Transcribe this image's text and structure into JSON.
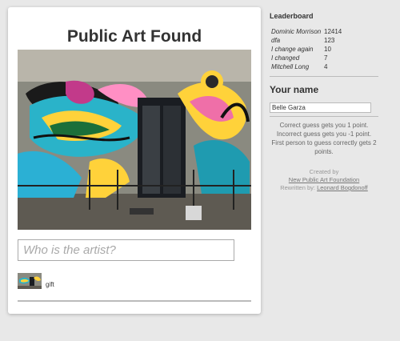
{
  "main": {
    "title": "Public Art Found",
    "image_alt": "graffiti mural",
    "guess_placeholder": "Who is the artist?",
    "guess_value": "",
    "thumb_label": "gift"
  },
  "leaderboard": {
    "title": "Leaderboard",
    "rows": [
      {
        "name": "Dominic Morrison",
        "score": "12414"
      },
      {
        "name": "dfa",
        "score": "123"
      },
      {
        "name": "I change again",
        "score": "10"
      },
      {
        "name": "I changed",
        "score": "7"
      },
      {
        "name": "Mitchell Long",
        "score": "4"
      }
    ]
  },
  "your_name": {
    "title": "Your name",
    "value": "Belle Garza"
  },
  "rules": {
    "line1": "Correct guess gets you 1 point.",
    "line2": "Incorrect guess gets you -1 point.",
    "line3": "First person to guess correctly gets 2 points."
  },
  "credits": {
    "created_by": "Created by",
    "org_link": "New Public Art Foundation",
    "rewritten_by": "Rewritten by:",
    "author_link": "Leonard Bogdonoff"
  }
}
